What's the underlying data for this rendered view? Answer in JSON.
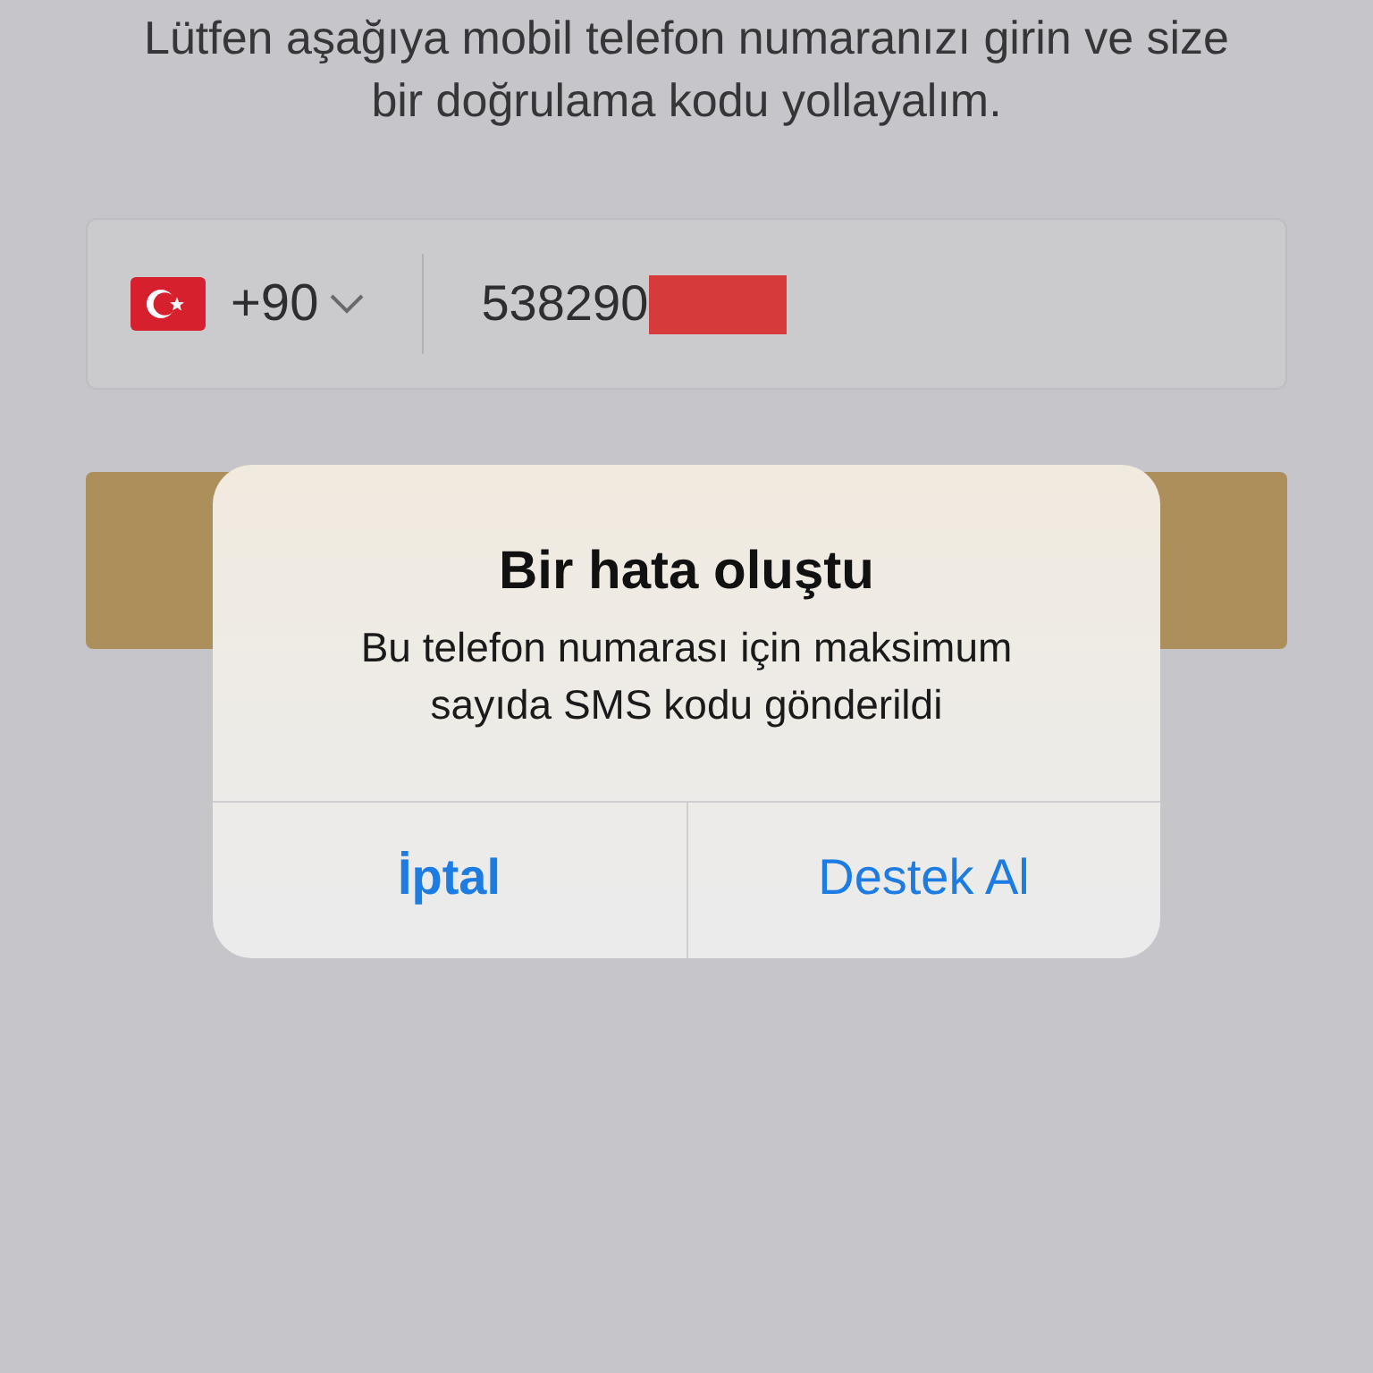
{
  "intro": {
    "text": "Lütfen aşağıya mobil telefon numaranızı girin ve size bir doğrulama kodu yollayalım."
  },
  "phone_field": {
    "country_code": "+90",
    "value": "538290",
    "redacted": true
  },
  "alert": {
    "title": "Bir hata oluştu",
    "message": "Bu telefon numarası için maksimum sayıda SMS kodu gönderildi",
    "buttons": [
      {
        "label": "İptal",
        "preferred": true
      },
      {
        "label": "Destek Al",
        "preferred": false
      }
    ]
  }
}
